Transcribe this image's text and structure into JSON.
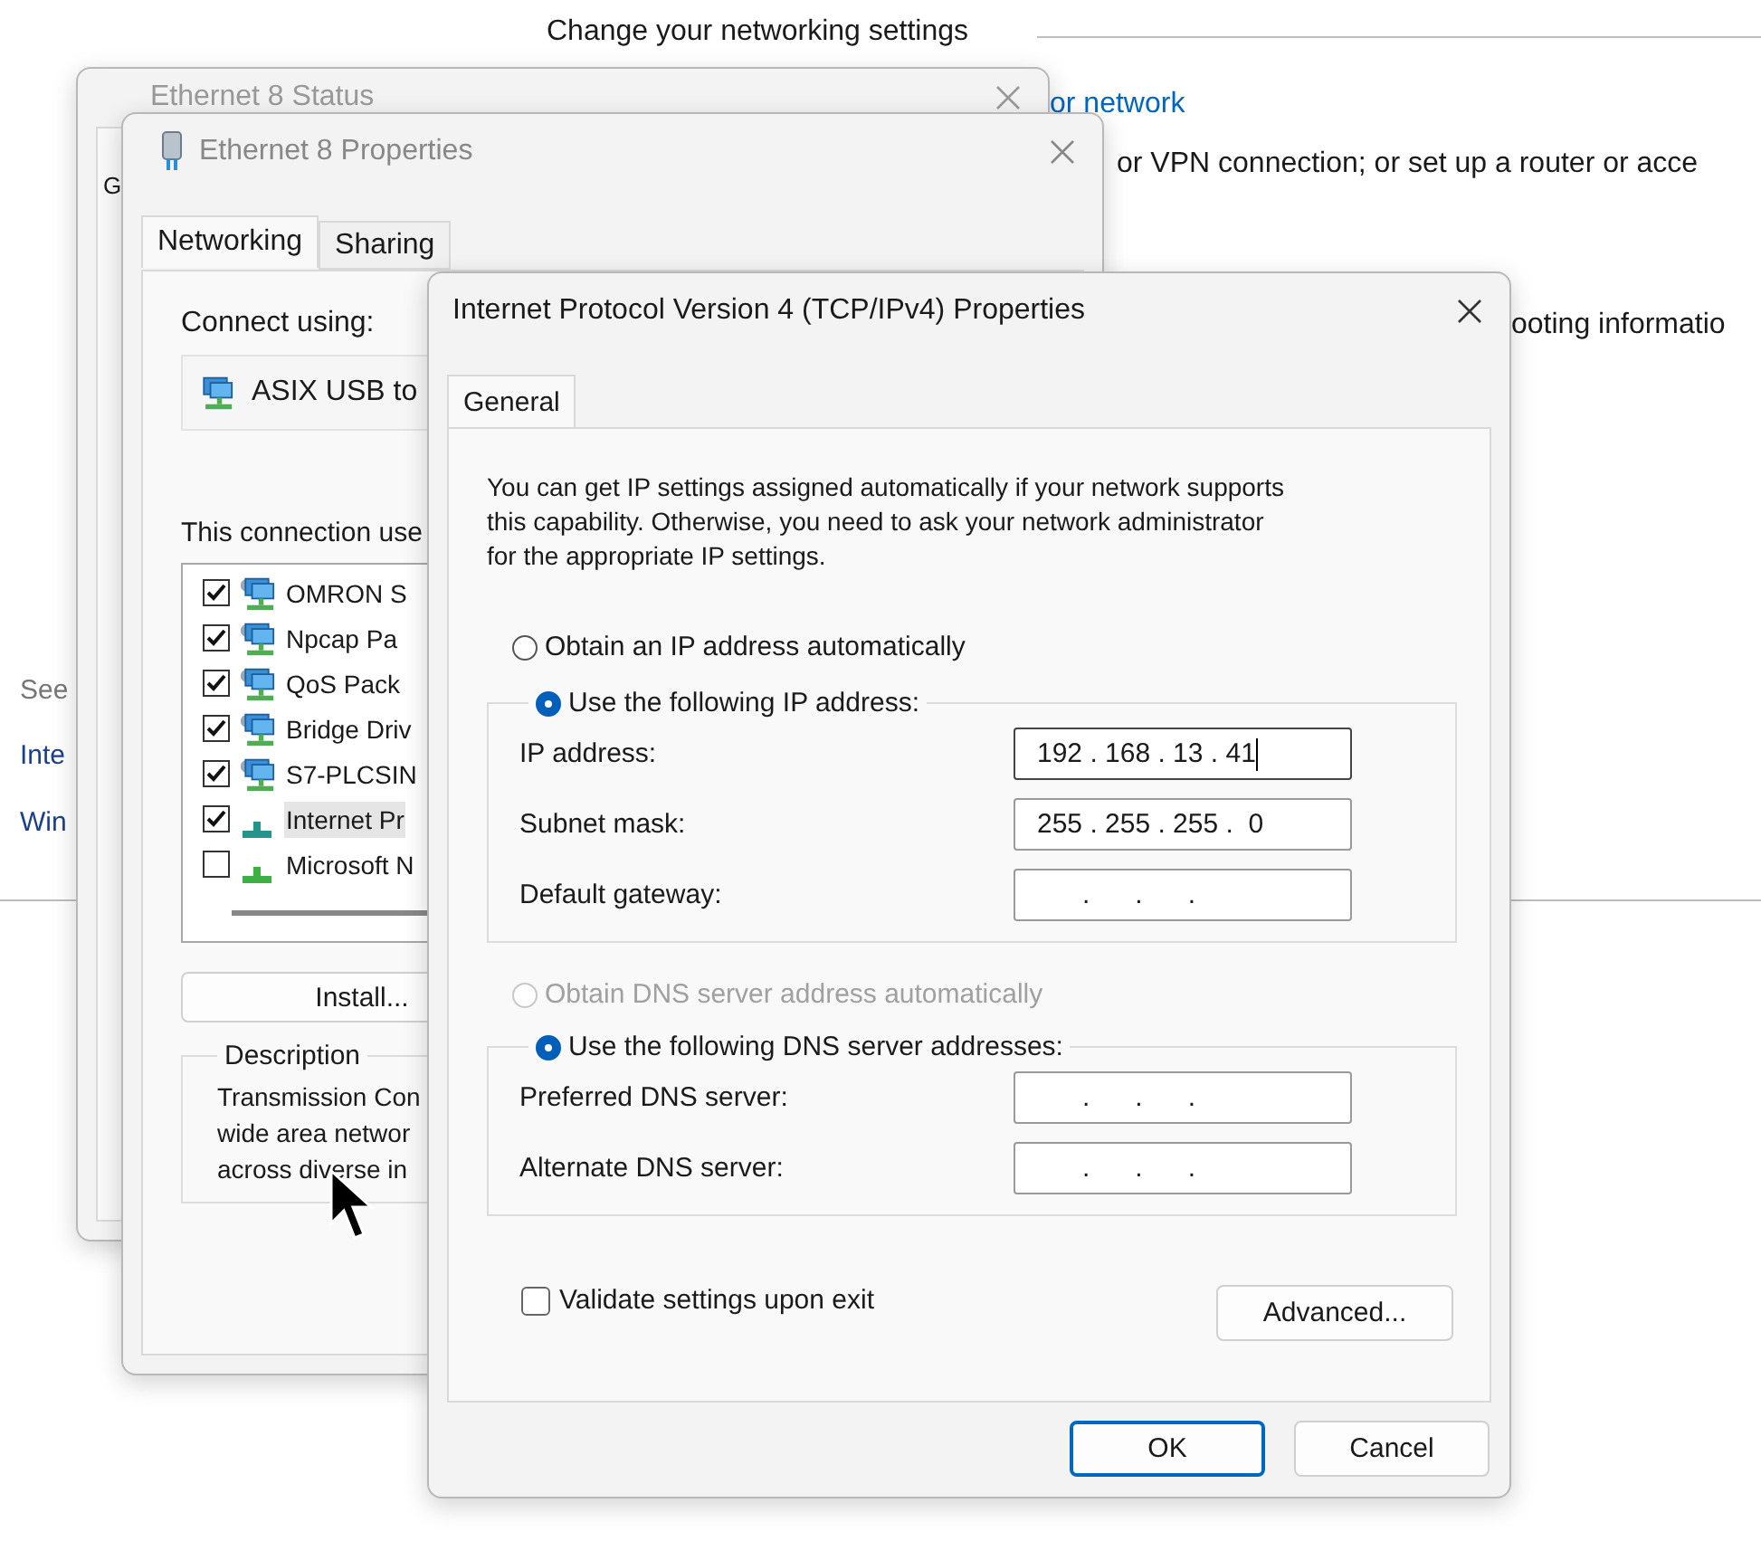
{
  "background": {
    "heading": "Change your networking settings",
    "link": "or network",
    "line_1": "or VPN connection; or set up a router or acce",
    "line_2": "ooting informatio",
    "see_also": {
      "title": "See",
      "links": [
        "Inte",
        "Win"
      ]
    }
  },
  "status_window": {
    "title": "Ethernet 8 Status",
    "tab": "G"
  },
  "properties_window": {
    "title": "Ethernet 8 Properties",
    "tabs": [
      {
        "label": "Networking",
        "selected": true
      },
      {
        "label": "Sharing",
        "selected": false
      }
    ],
    "connect_using": "Connect using:",
    "adapter": "ASIX USB to",
    "items_label": "This connection use",
    "items": [
      {
        "label": "OMRON S",
        "checked": true,
        "selected": false,
        "kind": "service"
      },
      {
        "label": "Npcap Pa",
        "checked": true,
        "selected": false,
        "kind": "service"
      },
      {
        "label": "QoS Pack",
        "checked": true,
        "selected": false,
        "kind": "service"
      },
      {
        "label": "Bridge Driv",
        "checked": true,
        "selected": false,
        "kind": "service"
      },
      {
        "label": "S7-PLCSIN",
        "checked": true,
        "selected": false,
        "kind": "service"
      },
      {
        "label": "Internet Pr",
        "checked": true,
        "selected": true,
        "kind": "protocol"
      },
      {
        "label": "Microsoft N",
        "checked": false,
        "selected": false,
        "kind": "protocol"
      }
    ],
    "install_button": "Install...",
    "description": {
      "title": "Description",
      "lines": [
        "Transmission Con",
        "wide area networ",
        "across diverse in"
      ]
    }
  },
  "ipv4_dialog": {
    "title": "Internet Protocol Version 4 (TCP/IPv4) Properties",
    "tabs": [
      {
        "label": "General",
        "selected": true
      }
    ],
    "intro": "You can get IP settings assigned automatically if your network supports\nthis capability. Otherwise, you need to ask your network administrator\nfor the appropriate IP settings.",
    "ip_mode": [
      {
        "label": "Obtain an IP address automatically",
        "selected": false,
        "disabled": false
      },
      {
        "label": "Use the following IP address:",
        "selected": true,
        "disabled": false
      }
    ],
    "ip_fields": [
      {
        "label": "IP address:",
        "value": "192 . 168 . 13 . 41",
        "focused": true
      },
      {
        "label": "Subnet mask:",
        "value": "255 . 255 . 255 .  0",
        "focused": false
      },
      {
        "label": "Default gateway:",
        "value": "      .      .      .",
        "focused": false
      }
    ],
    "dns_mode": [
      {
        "label": "Obtain DNS server address automatically",
        "selected": false,
        "disabled": true
      },
      {
        "label": "Use the following DNS server addresses:",
        "selected": true,
        "disabled": false
      }
    ],
    "dns_fields": [
      {
        "label": "Preferred DNS server:",
        "value": "      .      .      .",
        "focused": false
      },
      {
        "label": "Alternate DNS server:",
        "value": "      .      .      .",
        "focused": false
      }
    ],
    "validate": {
      "label": "Validate settings upon exit",
      "checked": false
    },
    "advanced_button": "Advanced...",
    "buttons": [
      {
        "label": "OK",
        "default": true
      },
      {
        "label": "Cancel",
        "default": false
      }
    ]
  }
}
